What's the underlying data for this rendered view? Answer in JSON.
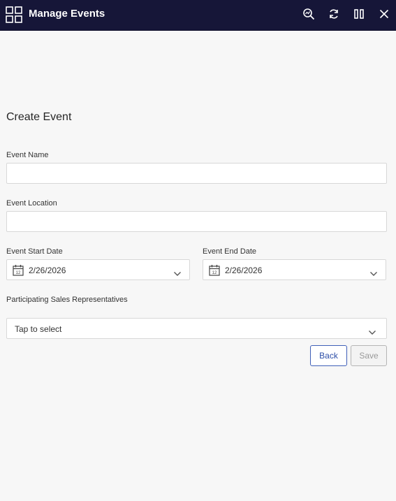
{
  "header": {
    "title": "Manage Events",
    "icons": [
      "app-grid-icon",
      "search-analytics-icon",
      "refresh-icon",
      "columns-icon",
      "close-icon"
    ]
  },
  "form": {
    "title": "Create Event",
    "event_name": {
      "label": "Event Name",
      "value": "",
      "placeholder": ""
    },
    "event_location": {
      "label": "Event Location",
      "value": "",
      "placeholder": ""
    },
    "start_date": {
      "label": "Event Start Date",
      "value": "2/26/2026",
      "icon": "calendar-icon"
    },
    "end_date": {
      "label": "Event End Date",
      "value": "2/26/2026",
      "icon": "calendar-icon"
    },
    "sales_reps": {
      "label": "Participating Sales Representatives",
      "value": "Tap to select"
    },
    "back_label": "Back",
    "save_label": "Save"
  },
  "colors": {
    "header_bg": "#161638",
    "page_bg": "#f7f7f7",
    "accent": "#2d4fa8",
    "disabled": "#9a9a9a"
  }
}
